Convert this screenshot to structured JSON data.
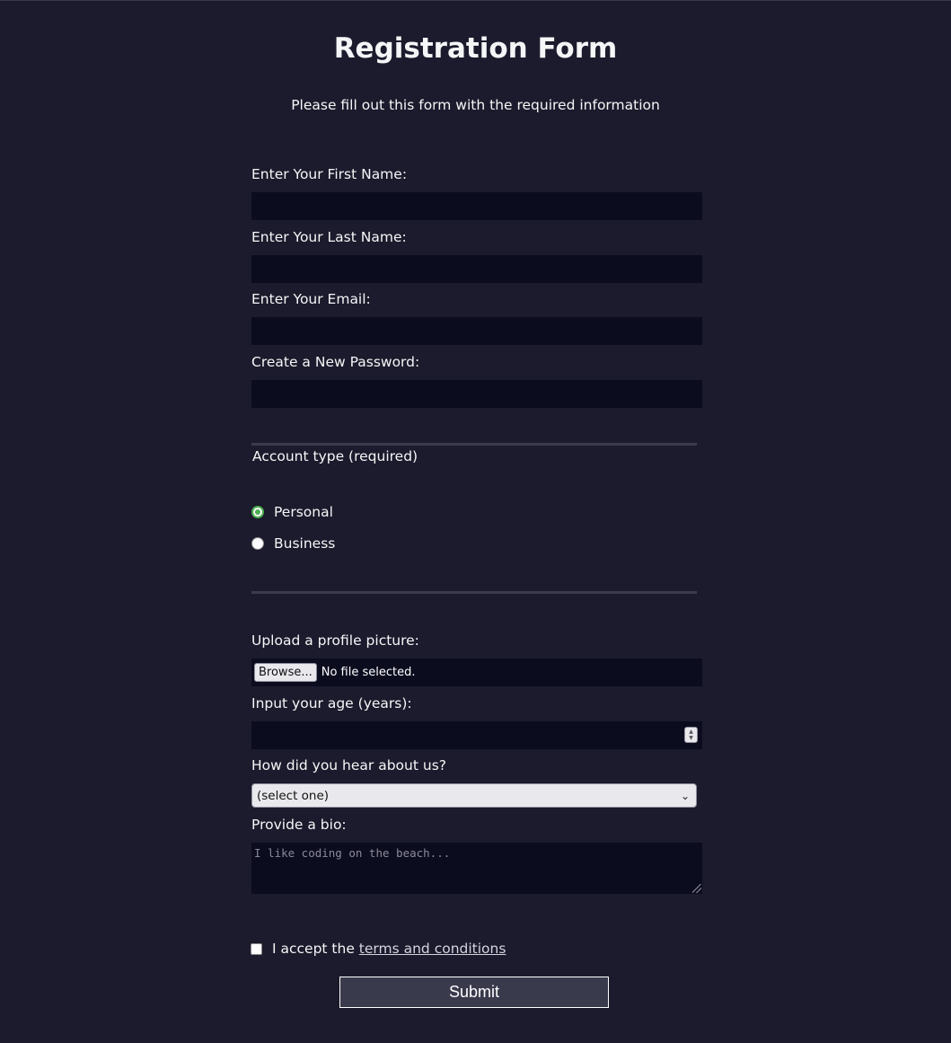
{
  "header": {
    "title": "Registration Form",
    "subtitle": "Please fill out this form with the required information"
  },
  "fields": {
    "first_name": {
      "label": "Enter Your First Name:",
      "value": ""
    },
    "last_name": {
      "label": "Enter Your Last Name:",
      "value": ""
    },
    "email": {
      "label": "Enter Your Email:",
      "value": ""
    },
    "password": {
      "label": "Create a New Password:",
      "value": ""
    }
  },
  "account_type": {
    "legend": "Account type (required)",
    "options": [
      {
        "label": "Personal",
        "selected": true
      },
      {
        "label": "Business",
        "selected": false
      }
    ]
  },
  "profile_picture": {
    "label": "Upload a profile picture:",
    "button_label": "Browse...",
    "status": "No file selected."
  },
  "age": {
    "label": "Input your age (years):",
    "value": ""
  },
  "referral": {
    "label": "How did you hear about us?",
    "selected": "(select one)"
  },
  "bio": {
    "label": "Provide a bio:",
    "placeholder": "I like coding on the beach..."
  },
  "terms": {
    "prefix": "I accept the ",
    "link_text": "terms and conditions",
    "checked": false
  },
  "submit_label": "Submit",
  "colors": {
    "background": "#1c1b2d",
    "input_background": "#0c0c1f",
    "radio_accent": "#4caf50",
    "submit_background": "#3a3a4d"
  },
  "icons": {
    "select_chevron": "chevron-down-icon",
    "number_spinner": "spinner-arrows-icon",
    "textarea_grip": "resize-grip-icon"
  }
}
